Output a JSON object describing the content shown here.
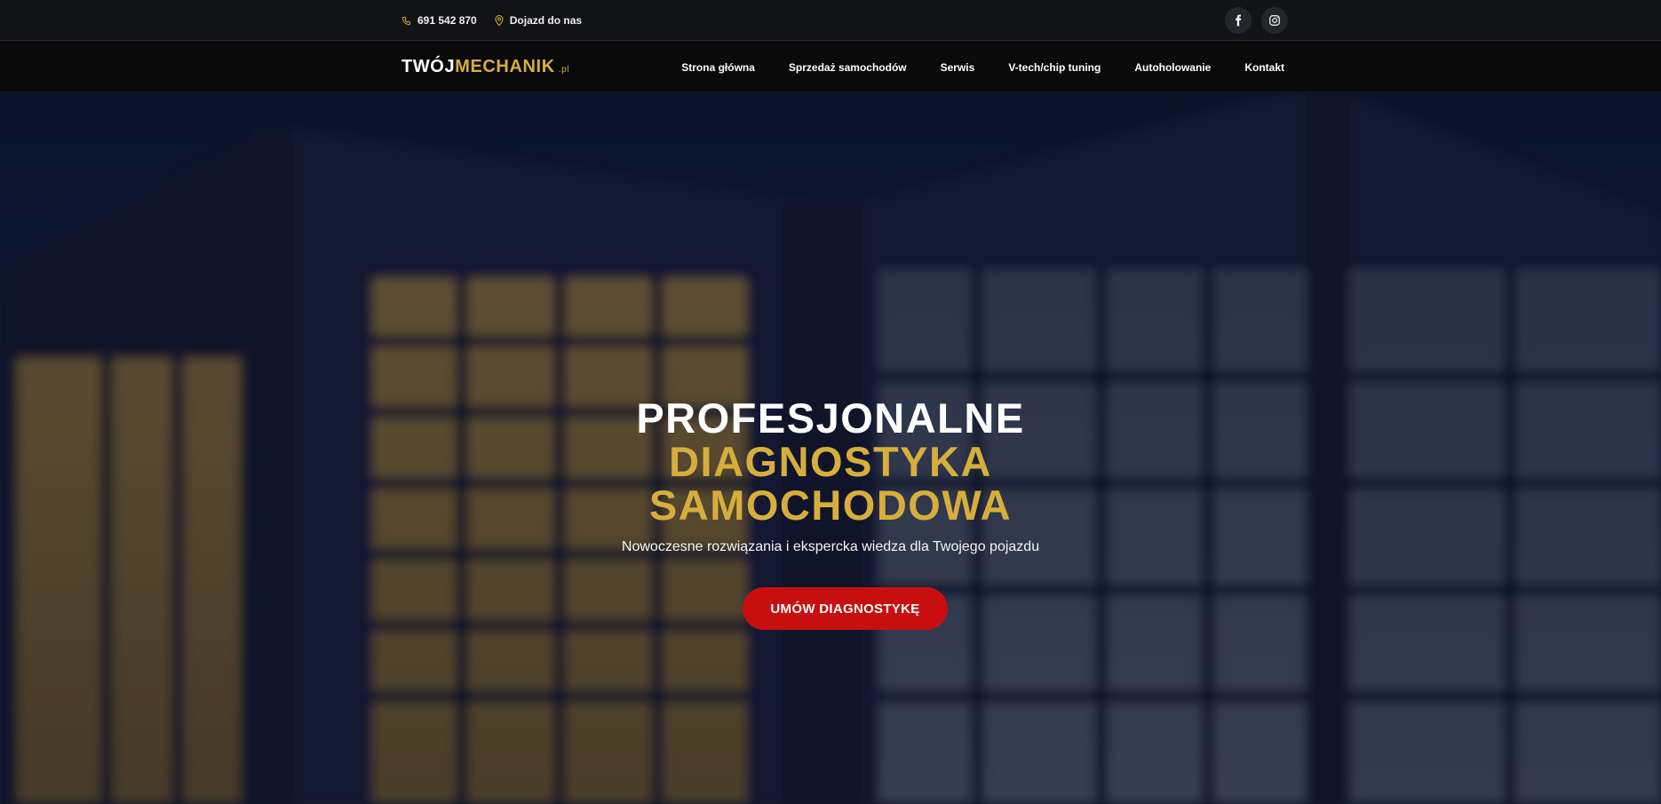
{
  "topbar": {
    "phone": "691 542 870",
    "location": "Dojazd do nas",
    "phone_icon": "phone-icon",
    "location_icon": "location-pin-icon",
    "socials": [
      "facebook-icon",
      "instagram-icon"
    ]
  },
  "nav": {
    "logo_white": "TWÓJ",
    "logo_gold": "MECHANIK",
    "logo_suffix": ".pl",
    "items": [
      "Strona główna",
      "Sprzedaż samochodów",
      "Serwis",
      "V-tech/chip tuning",
      "Autoholowanie",
      "Kontakt"
    ]
  },
  "hero": {
    "line1": "PROFESJONALNE",
    "line2": "DIAGNOSTYKA",
    "line3": "SAMOCHODOWA",
    "subtitle": "Nowoczesne rozwiązania i ekspercka wiedza dla Twojego pojazdu",
    "cta": "UMÓW DIAGNOSTYKĘ"
  },
  "colors": {
    "accent_gold": "#d6ae3c",
    "cta_red": "#c80f0f",
    "bar_dark": "#121317"
  }
}
